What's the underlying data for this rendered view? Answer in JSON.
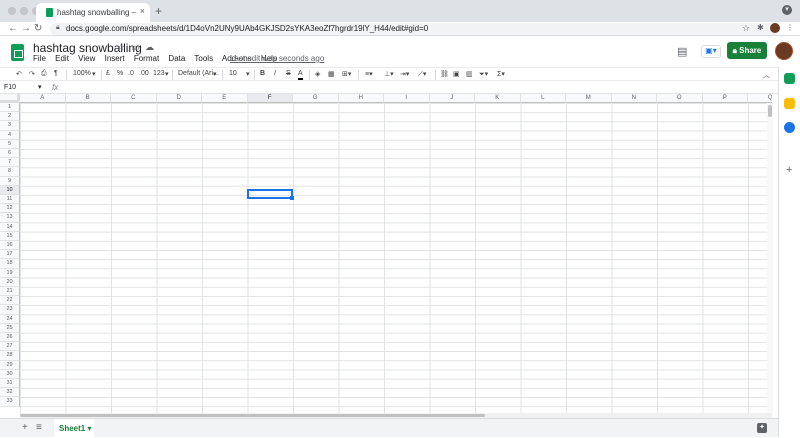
{
  "browser": {
    "tab_title": "hashtag snowballing – Google Sheets",
    "tab_close": "×",
    "new_tab": "+",
    "url": "docs.google.com/spreadsheets/d/1D4oVn2UNy9UAb4GKJSD2sYKA3eoZf7hgrdr19lY_H44/edit#gid=0",
    "back": "←",
    "forward": "→",
    "reload": "↻",
    "star": "☆"
  },
  "doc": {
    "title": "hashtag snowballing",
    "menu": [
      "File",
      "Edit",
      "View",
      "Insert",
      "Format",
      "Data",
      "Tools",
      "Add-ons",
      "Help"
    ],
    "last_edit": "Last edit was seconds ago",
    "share_label": "Share"
  },
  "toolbar": {
    "zoom": "100%",
    "currency": "£",
    "percent": "%",
    "decimal_dec": ".0",
    "decimal_inc": ".00",
    "more_formats": "123",
    "font": "Default (Ari...",
    "font_size": "10",
    "bold": "B",
    "italic": "I",
    "strike": "S",
    "text_color": "A"
  },
  "formula_bar": {
    "name_box": "F10",
    "fx": "fx"
  },
  "grid": {
    "columns": [
      "A",
      "B",
      "C",
      "D",
      "E",
      "F",
      "G",
      "H",
      "I",
      "J",
      "K",
      "L",
      "M",
      "N",
      "O",
      "P",
      "Q"
    ],
    "rows": [
      "1",
      "2",
      "3",
      "4",
      "5",
      "6",
      "7",
      "8",
      "9",
      "10",
      "11",
      "12",
      "13",
      "14",
      "15",
      "16",
      "17",
      "18",
      "19",
      "20",
      "21",
      "22",
      "23",
      "24",
      "25",
      "26",
      "27",
      "28",
      "29",
      "30",
      "31",
      "32",
      "33"
    ],
    "selected_column": "F",
    "selected_row": "10"
  },
  "sheets": {
    "tabs": [
      "Sheet1"
    ]
  },
  "colors": {
    "share": "#188038",
    "selection": "#1a73e8",
    "sheets_brand": "#0f9d58"
  }
}
